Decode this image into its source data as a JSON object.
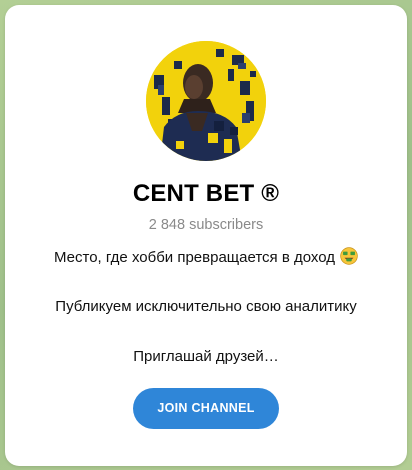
{
  "channel": {
    "name": "CENT BET ®",
    "subscribers": "2 848 subscribers",
    "description": {
      "line1": "Место, где хобби превращается в доход",
      "line1_emoji": "money-mouth-face-icon",
      "line2": "Публикуем исключительно свою аналитику",
      "line3": "Приглашай друзей…"
    },
    "join_label": "JOIN CHANNEL"
  },
  "colors": {
    "accent": "#2f86d8",
    "avatar_bg": "#f2d20c",
    "background": "#a7c58f"
  }
}
